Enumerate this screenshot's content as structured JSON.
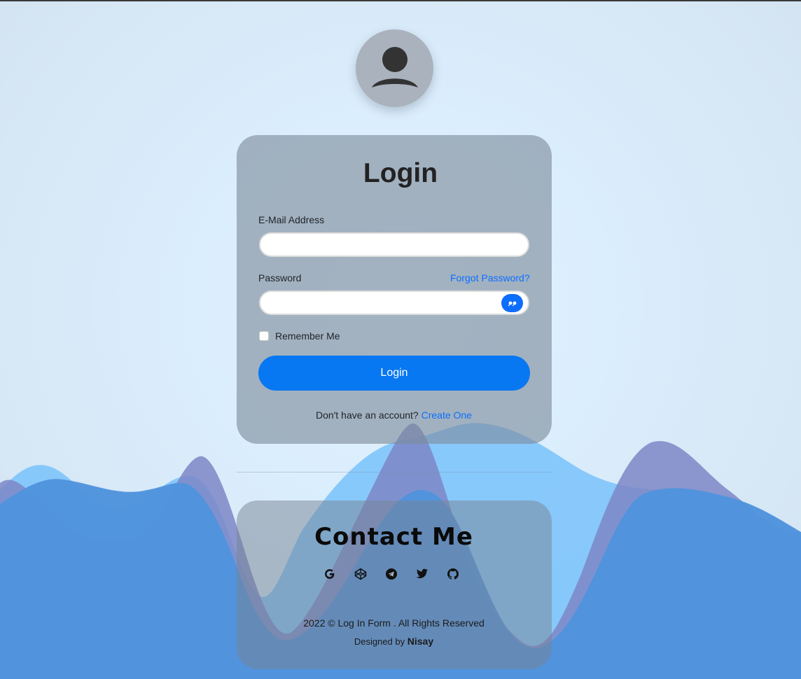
{
  "login_card": {
    "title": "Login",
    "email_label": "E-Mail Address",
    "email_value": "",
    "password_label": "Password",
    "password_value": "",
    "forgot_link": "Forgot Password?",
    "remember_label": "Remember Me",
    "remember_checked": false,
    "submit_label": "Login",
    "signup_prompt": "Don't have an account?",
    "signup_link": "Create One"
  },
  "contact": {
    "title": "Contact Me",
    "icons": [
      "google-icon",
      "codepen-icon",
      "telegram-icon",
      "twitter-icon",
      "github-icon"
    ],
    "copyright": "2022 © Log In Form . All Rights Reserved",
    "designed_by_prefix": "Designed by",
    "designer": "Nisay"
  },
  "colors": {
    "primary": "#0877f2",
    "link": "#0d6efd",
    "wave_light": "#7ec4fb",
    "wave_purple": "#7c87c6",
    "wave_blue": "#4f93dd"
  }
}
